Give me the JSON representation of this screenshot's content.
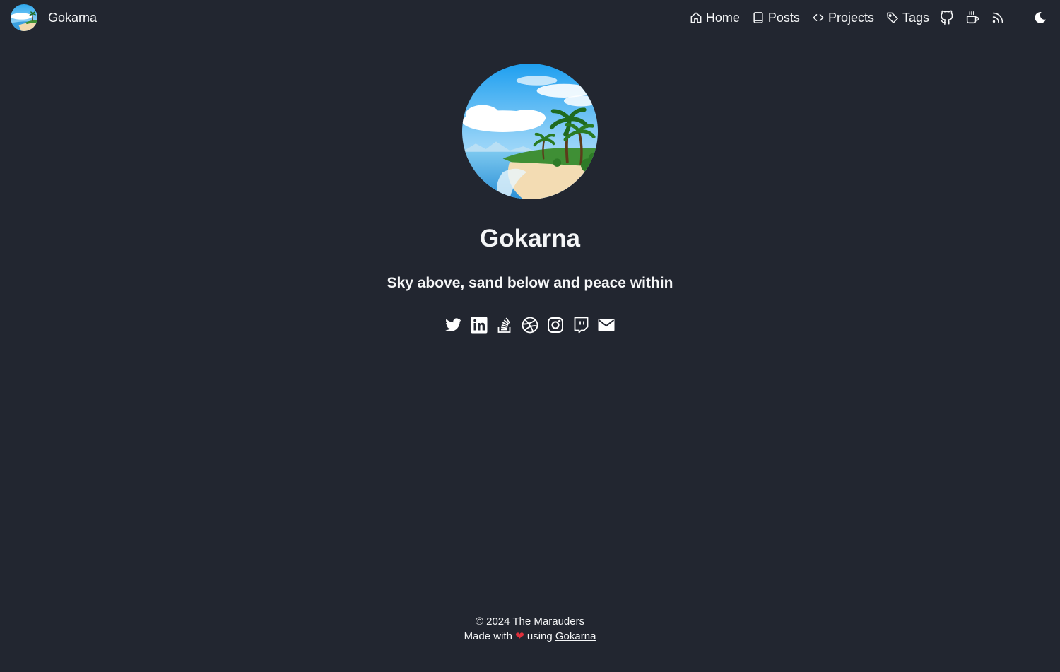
{
  "header": {
    "brand_title": "Gokarna",
    "nav": [
      {
        "label": "Home",
        "icon": "home-icon"
      },
      {
        "label": "Posts",
        "icon": "book-icon"
      },
      {
        "label": "Projects",
        "icon": "code-icon"
      },
      {
        "label": "Tags",
        "icon": "tag-icon"
      }
    ],
    "icon_links": [
      "github-icon",
      "coffee-icon",
      "rss-icon"
    ],
    "theme_toggle_icon": "moon-icon"
  },
  "hero": {
    "title": "Gokarna",
    "tagline": "Sky above, sand below and peace within",
    "social_icons": [
      "twitter-icon",
      "linkedin-icon",
      "stackoverflow-icon",
      "dribbble-icon",
      "instagram-icon",
      "twitch-icon",
      "email-icon"
    ]
  },
  "footer": {
    "copyright": "© 2024 The Marauders",
    "made_with": "Made with",
    "heart": "❤",
    "using": "using",
    "link_text": "Gokarna"
  },
  "colors": {
    "background": "#222630",
    "text": "#f5f6f7",
    "heart": "#e0303c"
  }
}
